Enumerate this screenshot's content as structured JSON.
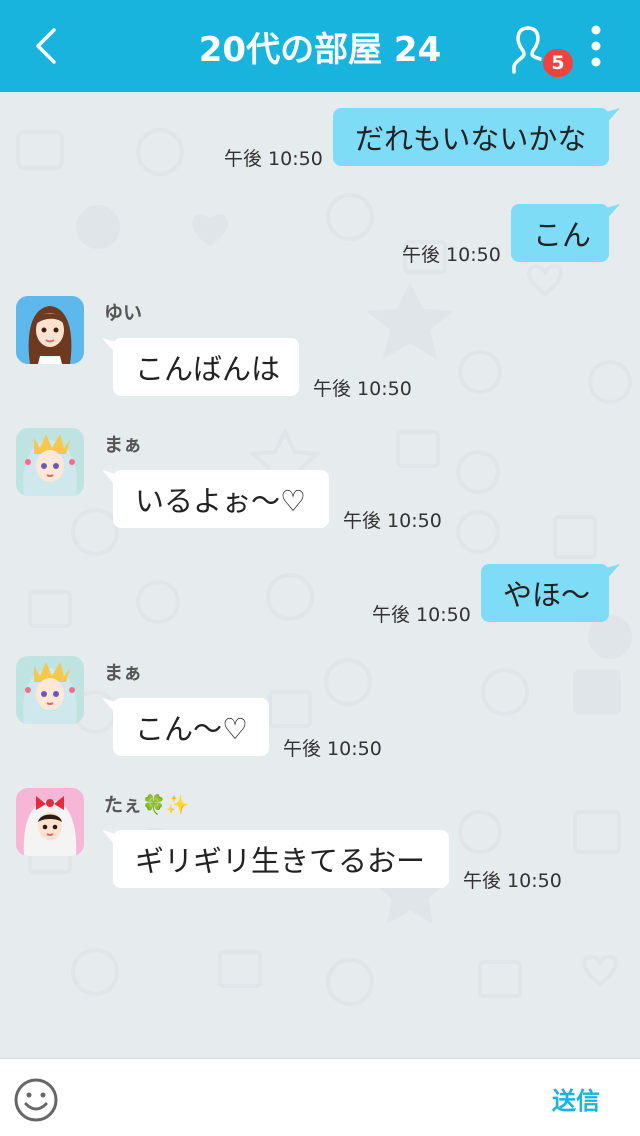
{
  "header": {
    "title": "20代の部屋 24",
    "member_badge": "5"
  },
  "messages": [
    {
      "side": "mine",
      "text": "だれもいないかな",
      "time": "午後 10:50"
    },
    {
      "side": "mine",
      "text": "こん",
      "time": "午後 10:50"
    },
    {
      "side": "theirs",
      "name": "ゆい",
      "text": "こんばんは",
      "time": "午後 10:50"
    },
    {
      "side": "theirs",
      "name": "まぁ",
      "text": "いるよぉ〜♡",
      "time": "午後 10:50"
    },
    {
      "side": "mine",
      "text": "やほ〜",
      "time": "午後 10:50"
    },
    {
      "side": "theirs",
      "name": "まぁ",
      "text": "こん〜♡",
      "time": "午後 10:50"
    },
    {
      "side": "theirs",
      "name": "たぇ🍀✨",
      "text": "ギリギリ生きてるおー",
      "time": "午後 10:50"
    }
  ],
  "footer": {
    "input_value": "",
    "send_label": "送信"
  },
  "colors": {
    "header": "#18b4dd",
    "my_bubble": "#7fdcf7",
    "their_bubble": "#ffffff",
    "badge": "#f0423f"
  },
  "icons": [
    "back-chevron-icon",
    "members-icon",
    "more-vertical-icon",
    "emoji-icon"
  ]
}
